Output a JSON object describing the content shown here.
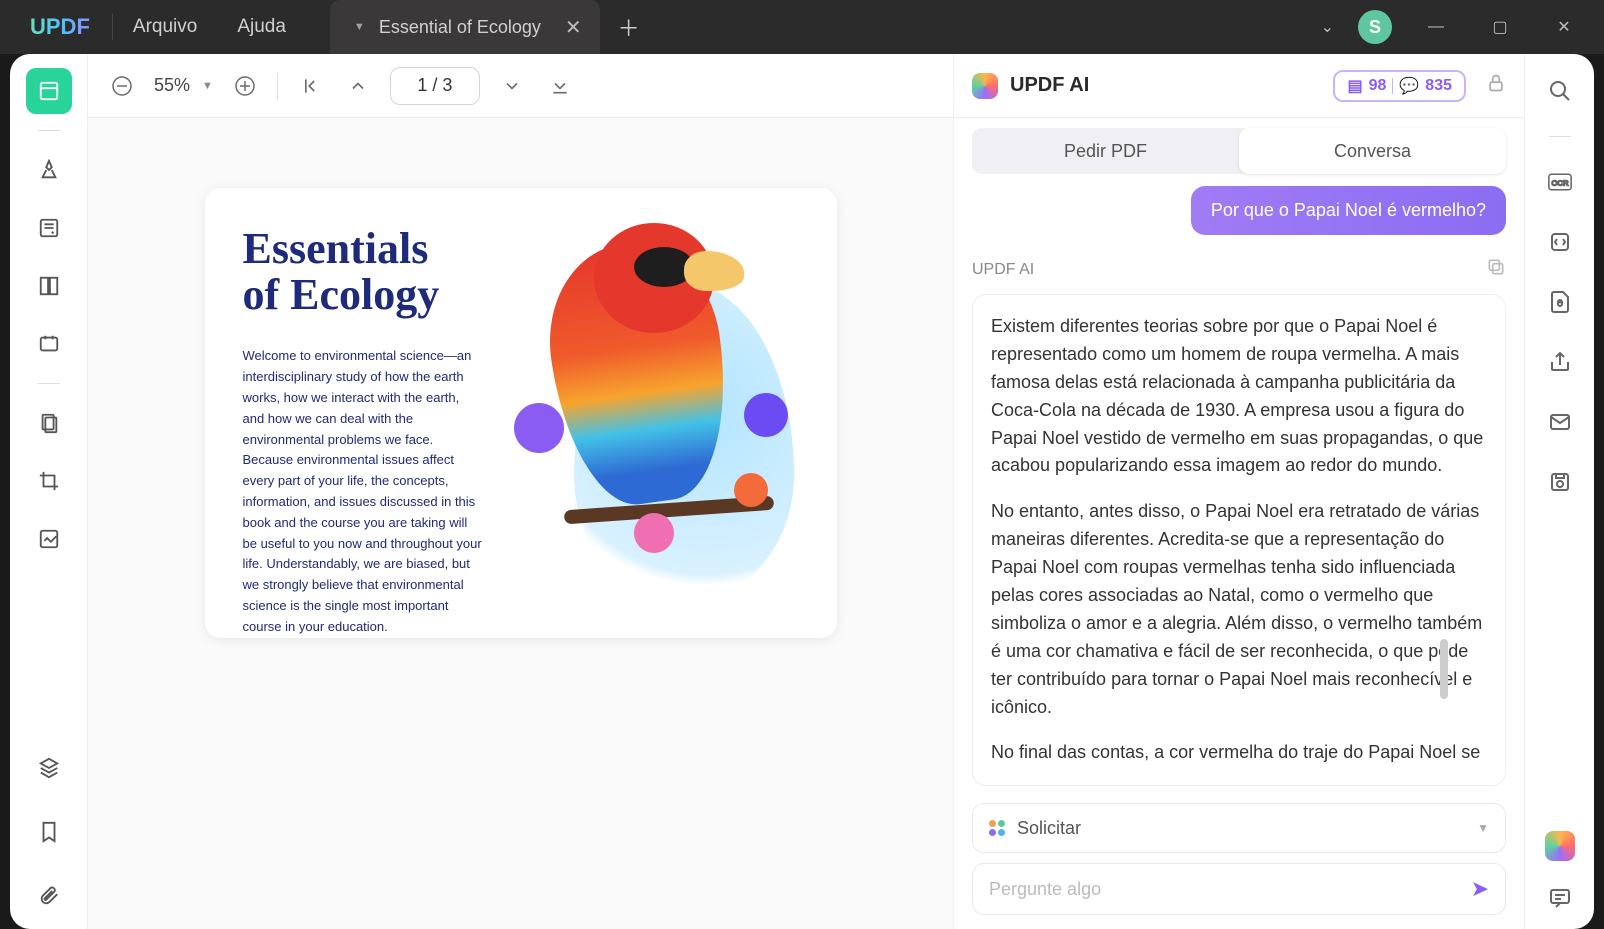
{
  "menu": {
    "arquivo": "Arquivo",
    "ajuda": "Ajuda"
  },
  "tab": {
    "title": "Essential of Ecology"
  },
  "avatar": "S",
  "toolbar": {
    "zoom": "55%",
    "page": "1 / 3"
  },
  "document": {
    "title_line1": "Essentials",
    "title_line2": "of Ecology",
    "body": "Welcome to environmental science—an interdisciplinary study of how the earth works, how we interact with the earth, and how we can deal with the environmental problems we face. Because environmental issues affect every part of your life, the concepts, information, and issues discussed in this book and the course you are taking will be useful to you now and throughout your life. Understandably, we are biased, but we strongly believe that environmental science is the single most important course in your education."
  },
  "ai": {
    "title": "UPDF AI",
    "credit1": "98",
    "credit2": "835",
    "tab_pedir": "Pedir PDF",
    "tab_conversa": "Conversa",
    "user_msg": "Por que o Papai Noel é vermelho?",
    "label": "UPDF AI",
    "response_p1": "Existem diferentes teorias sobre por que o Papai Noel é representado como um homem de roupa vermelha. A mais famosa delas está relacionada à campanha publicitária da Coca-Cola na década de 1930. A empresa usou a figura do Papai Noel vestido de vermelho em suas propagandas, o que acabou popularizando essa imagem ao redor do mundo.",
    "response_p2": "No entanto, antes disso, o Papai Noel era retratado de várias maneiras diferentes. Acredita-se que a representação do Papai Noel com roupas vermelhas tenha sido influenciada pelas cores associadas ao Natal, como o vermelho que simboliza o amor e a alegria. Além disso, o vermelho também é uma cor chamativa e fácil de ser reconhecida, o que pode ter contribuído para tornar o Papai Noel mais reconhecível e icônico.",
    "response_p3": "No final das contas, a cor vermelha do traje do Papai Noel se",
    "solicit": "Solicitar",
    "ask_placeholder": "Pergunte algo"
  }
}
